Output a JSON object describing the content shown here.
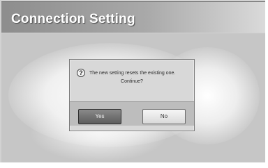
{
  "window": {
    "title": "Connection Setting"
  },
  "dialog": {
    "icon": "question-icon",
    "icon_glyph": "?",
    "message_line1": "The new setting resets the existing one.",
    "message_line2": "Continue?",
    "buttons": {
      "yes_label": "Yes",
      "no_label": "No"
    },
    "focused_button": "yes"
  },
  "colors": {
    "title_text": "#ffffff",
    "focused_button": "#5c5c5c",
    "unfocused_button": "#e0e0e0"
  }
}
